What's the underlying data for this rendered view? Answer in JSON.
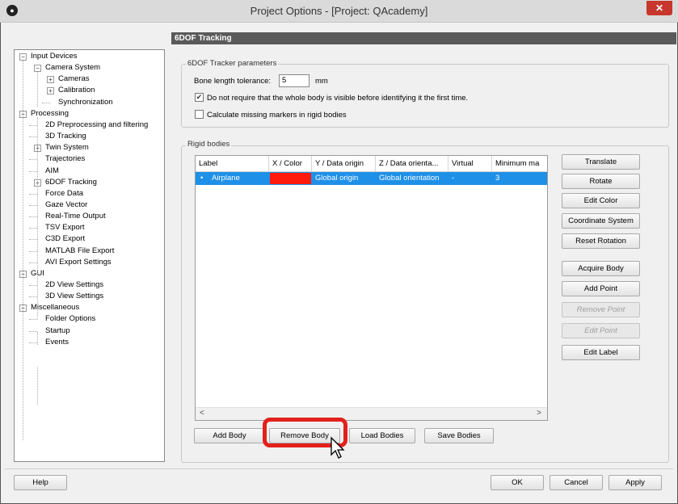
{
  "window": {
    "title": "Project Options - [Project: QAcademy]",
    "close_glyph": "✕"
  },
  "tree": [
    {
      "label": "Input Devices",
      "exp": "−"
    },
    {
      "label": "Camera System",
      "exp": "−"
    },
    {
      "label": "Cameras",
      "exp": "+"
    },
    {
      "label": "Calibration",
      "exp": "+"
    },
    {
      "label": "Synchronization",
      "exp": ""
    },
    {
      "label": "Processing",
      "exp": "−"
    },
    {
      "label": "2D Preprocessing and filtering",
      "exp": ""
    },
    {
      "label": "3D Tracking",
      "exp": ""
    },
    {
      "label": "Twin System",
      "exp": "+"
    },
    {
      "label": "Trajectories",
      "exp": ""
    },
    {
      "label": "AIM",
      "exp": ""
    },
    {
      "label": "6DOF Tracking",
      "exp": "+"
    },
    {
      "label": "Force Data",
      "exp": ""
    },
    {
      "label": "Gaze Vector",
      "exp": ""
    },
    {
      "label": "Real-Time Output",
      "exp": ""
    },
    {
      "label": "TSV Export",
      "exp": ""
    },
    {
      "label": "C3D Export",
      "exp": ""
    },
    {
      "label": "MATLAB File Export",
      "exp": ""
    },
    {
      "label": "AVI Export Settings",
      "exp": ""
    },
    {
      "label": "GUI",
      "exp": "−"
    },
    {
      "label": "2D View Settings",
      "exp": ""
    },
    {
      "label": "3D View Settings",
      "exp": ""
    },
    {
      "label": "Miscellaneous",
      "exp": "−"
    },
    {
      "label": "Folder Options",
      "exp": ""
    },
    {
      "label": "Startup",
      "exp": ""
    },
    {
      "label": "Events",
      "exp": ""
    }
  ],
  "section_title": "6DOF Tracking",
  "tracker": {
    "group_label": "6DOF Tracker parameters",
    "bone_label": "Bone length tolerance:",
    "bone_value": "5",
    "bone_unit": "mm",
    "opt1_label": "Do not require that the whole body is visible before identifying it the first time.",
    "opt1_mark": "✔",
    "opt2_label": "Calculate missing markers in rigid bodies",
    "opt2_mark": ""
  },
  "rigid": {
    "group_label": "Rigid bodies",
    "columns": [
      "Label",
      "X / Color",
      "Y / Data origin",
      "Z / Data orienta...",
      "Virtual",
      "Minimum ma"
    ],
    "row": {
      "bullet": "•",
      "label": "Airplane",
      "color_hex": "#ff1a0a",
      "y": "Global origin",
      "z": "Global orientation",
      "virtual": "-",
      "min": "3"
    },
    "scroll_left": "<",
    "scroll_right": ">"
  },
  "side_buttons": [
    {
      "label": "Translate",
      "enabled": true
    },
    {
      "label": "Rotate",
      "enabled": true
    },
    {
      "label": "Edit Color",
      "enabled": true
    },
    {
      "label": "Coordinate System",
      "enabled": true
    },
    {
      "label": "Reset Rotation",
      "enabled": true
    },
    {
      "label": "Acquire Body",
      "enabled": true
    },
    {
      "label": "Add Point",
      "enabled": true
    },
    {
      "label": "Remove Point",
      "enabled": false
    },
    {
      "label": "Edit Point",
      "enabled": false
    },
    {
      "label": "Edit Label",
      "enabled": true
    }
  ],
  "bottom_buttons": {
    "add_body": "Add Body",
    "remove_body": "Remove Body",
    "load_bodies": "Load Bodies",
    "save_bodies": "Save Bodies"
  },
  "footer": {
    "help": "Help",
    "ok": "OK",
    "cancel": "Cancel",
    "apply": "Apply"
  },
  "colors": {
    "highlight": "#e2211c",
    "selection": "#1e90e8",
    "header_bar": "#5a5a5a"
  }
}
